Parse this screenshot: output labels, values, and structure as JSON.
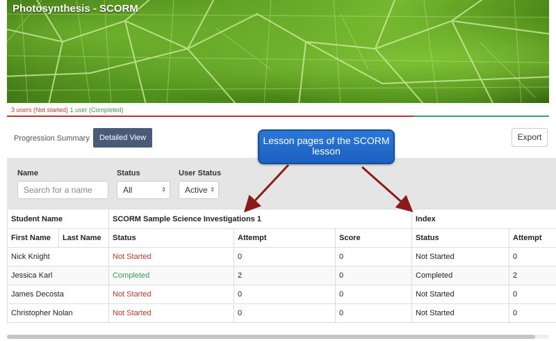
{
  "banner": {
    "title": "Photosynthesis - SCORM",
    "not_started_text": "3 users (Not started)",
    "completed_text": "1 user (Completed)",
    "progress_not_started_fraction": 0.75,
    "colors": {
      "not_started": "#c9302c",
      "completed": "#3aa069"
    }
  },
  "toolbar": {
    "progression_tab": "Progression Summary",
    "detailed_tab": "Detailed View",
    "export_label": "Export"
  },
  "filters": {
    "name_label": "Name",
    "name_placeholder": "Search for a name",
    "status_label": "Status",
    "status_value": "All",
    "user_status_label": "User Status",
    "user_status_value": "Active"
  },
  "callout": {
    "line1": "Lesson pages of the SCORM",
    "line2": "lesson"
  },
  "table": {
    "group_headers": {
      "student": "Student Name",
      "lesson1": "SCORM Sample Science Investigations 1",
      "lesson2": "Index"
    },
    "columns": [
      "First Name",
      "Last Name",
      "Status",
      "Attempt",
      "Score",
      "Status",
      "Attempt"
    ],
    "rows": [
      {
        "first": "Nick Knight",
        "last": "",
        "status1": "Not Started",
        "attempt1": "0",
        "score1": "0",
        "status2": "Not Started",
        "attempt2": "0"
      },
      {
        "first": "Jessica Karl",
        "last": "",
        "status1": "Completed",
        "attempt1": "2",
        "score1": "0",
        "status2": "Completed",
        "attempt2": "2"
      },
      {
        "first": "James Decosta",
        "last": "",
        "status1": "Not Started",
        "attempt1": "0",
        "score1": "0",
        "status2": "Not Started",
        "attempt2": "0"
      },
      {
        "first": "Christopher Nolan",
        "last": "",
        "status1": "Not Started",
        "attempt1": "0",
        "score1": "0",
        "status2": "Not Started",
        "attempt2": "0"
      }
    ]
  }
}
